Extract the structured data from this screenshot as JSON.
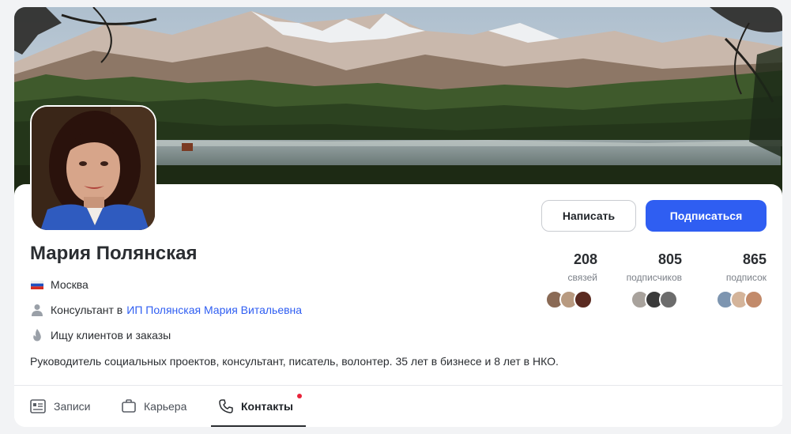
{
  "profile": {
    "name": "Мария Полянская",
    "city": "Москва",
    "job_prefix": "Консультант в",
    "company": "ИП Полянская Мария Витальевна",
    "seeking": "Ищу клиентов и заказы",
    "bio": "Руководитель социальных проектов, консультант, писатель, волонтер. 35 лет в бизнесе и 8 лет в НКО."
  },
  "actions": {
    "write_label": "Написать",
    "subscribe_label": "Подписаться"
  },
  "stats": [
    {
      "value": "208",
      "label": "связей"
    },
    {
      "value": "805",
      "label": "подписчиков"
    },
    {
      "value": "865",
      "label": "подписок"
    }
  ],
  "tabs": [
    {
      "label": "Записи",
      "icon": "document-icon"
    },
    {
      "label": "Карьера",
      "icon": "briefcase-icon"
    },
    {
      "label": "Контакты",
      "icon": "phone-icon",
      "active": true,
      "has_notification": true
    }
  ],
  "colors": {
    "accent": "#2f5ef2",
    "notification": "#e8233a"
  }
}
